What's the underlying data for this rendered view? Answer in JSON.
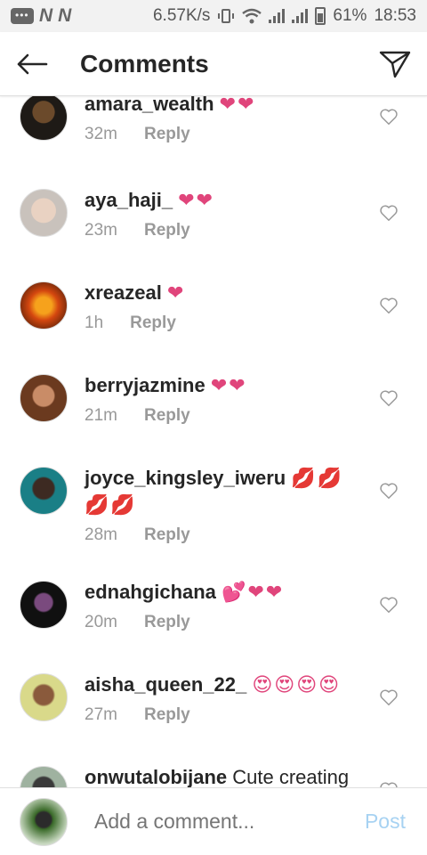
{
  "status_bar": {
    "speed": "6.57K/s",
    "battery": "61%",
    "time": "18:53"
  },
  "header": {
    "title": "Comments"
  },
  "comments": [
    {
      "username": "amara_wealth",
      "text": "",
      "emoji": "❤❤",
      "time": "32m",
      "reply_label": "Reply"
    },
    {
      "username": "aya_haji_",
      "text": "",
      "emoji": "❤❤",
      "time": "23m",
      "reply_label": "Reply"
    },
    {
      "username": "xreazeal",
      "text": "",
      "emoji": "❤",
      "time": "1h",
      "reply_label": "Reply"
    },
    {
      "username": "berryjazmine",
      "text": "",
      "emoji": "❤❤",
      "time": "21m",
      "reply_label": "Reply"
    },
    {
      "username": "joyce_kingsley_iweru",
      "text": "",
      "emoji": "💋💋 💋💋",
      "time": "28m",
      "reply_label": "Reply"
    },
    {
      "username": "ednahgichana",
      "text": "",
      "emoji": "💕❤❤",
      "time": "20m",
      "reply_label": "Reply"
    },
    {
      "username": "aisha_queen_22_",
      "text": "",
      "emoji": "😍😍😍😍",
      "time": "27m",
      "reply_label": "Reply"
    },
    {
      "username": "onwutalobijane",
      "text": "Cute creating",
      "emoji": "",
      "time": "",
      "reply_label": ""
    }
  ],
  "composer": {
    "placeholder": "Add a comment...",
    "post_label": "Post"
  },
  "colors": {
    "accent_post": "#a7d2f2",
    "heart": "#e0457b",
    "meta_text": "#999999"
  }
}
